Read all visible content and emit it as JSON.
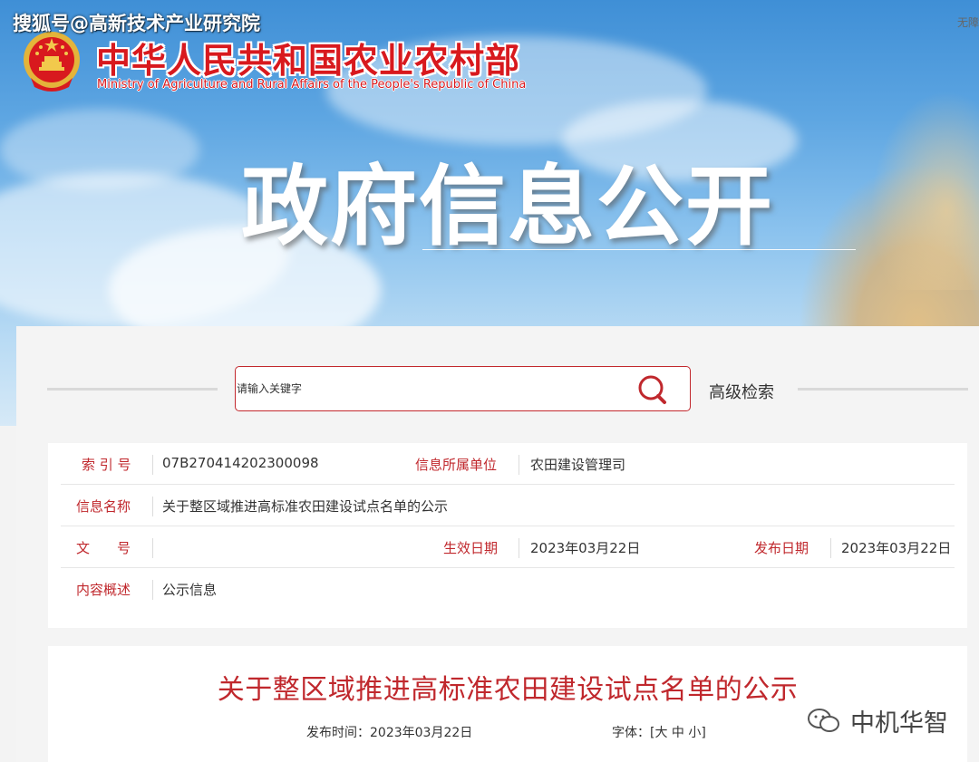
{
  "watermark_top": "搜狐号@高新技术产业研究院",
  "corner_text": "无障",
  "header": {
    "ministry_cn": "中华人民共和国农业农村部",
    "ministry_en": "Ministry of Agriculture and Rural Affairs of the People's Republic of China",
    "section_title": "政府信息公开"
  },
  "search": {
    "placeholder": "请输入关键字",
    "advanced_label": "高级检索"
  },
  "info": {
    "index_label": "索 引 号",
    "index_value": "07B270414202300098",
    "unit_label": "信息所属单位",
    "unit_value": "农田建设管理司",
    "name_label": "信息名称",
    "name_value": "关于整区域推进高标准农田建设试点名单的公示",
    "doc_no_label": "文　　号",
    "effective_label": "生效日期",
    "effective_value": "2023年03月22日",
    "publish_label": "发布日期",
    "publish_value": "2023年03月22日",
    "summary_label": "内容概述",
    "summary_value": "公示信息"
  },
  "article": {
    "title": "关于整区域推进高标准农田建设试点名单的公示",
    "publish_time_label": "发布时间：",
    "publish_time_value": "2023年03月22日",
    "font_label": "字体：[",
    "font_large": "大",
    "font_medium": "中",
    "font_small": "小",
    "font_end": "]"
  },
  "watermark_bottom": "中机华智",
  "colors": {
    "brand_red": "#c0282d",
    "title_red": "#d8191e"
  }
}
